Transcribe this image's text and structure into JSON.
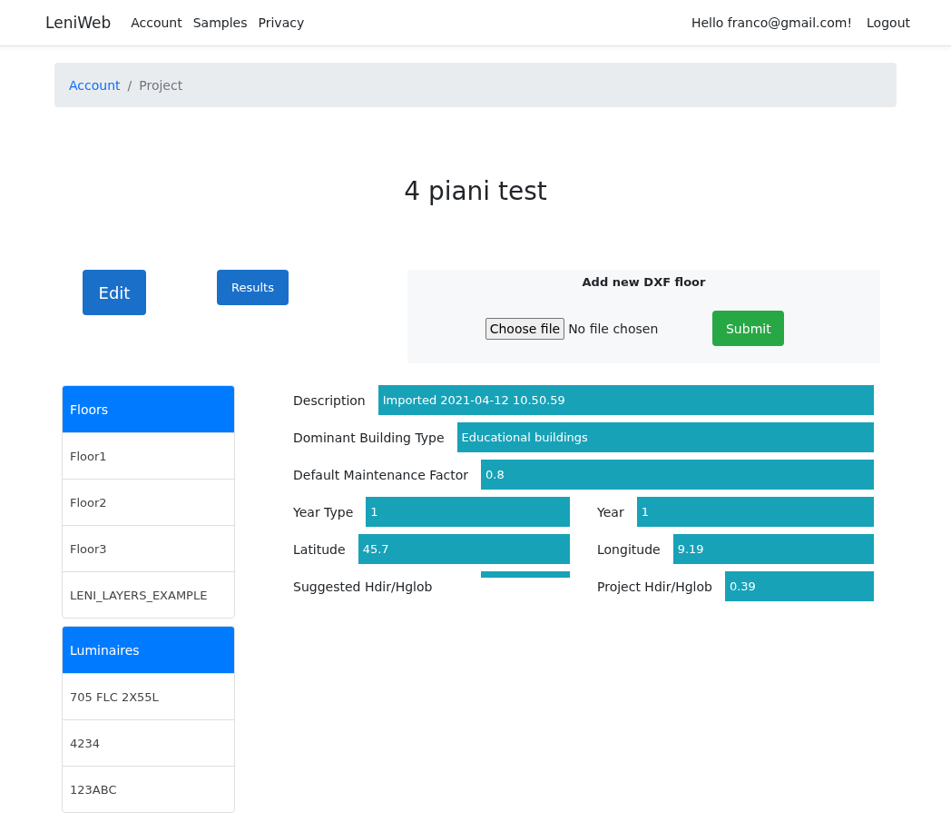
{
  "navbar": {
    "brand": "LeniWeb",
    "links": [
      "Account",
      "Samples",
      "Privacy"
    ],
    "greeting": "Hello franco@gmail.com!",
    "logout": "Logout"
  },
  "breadcrumb": {
    "separator": "/",
    "items": [
      {
        "label": "Account",
        "link": true
      },
      {
        "label": "Project",
        "link": false
      }
    ]
  },
  "title": "4 piani test",
  "actions": {
    "edit": "Edit",
    "results": "Results"
  },
  "upload": {
    "title": "Add new DXF floor",
    "choose": "Choose file",
    "status": "No file chosen",
    "submit": "Submit"
  },
  "lists": [
    {
      "header": "Floors",
      "items": [
        "Floor1",
        "Floor2",
        "Floor3",
        "LENI_LAYERS_EXAMPLE"
      ]
    },
    {
      "header": "Luminaires",
      "items": [
        "705 FLC 2X55L",
        "4234",
        "123ABC"
      ]
    }
  ],
  "fields": [
    {
      "kind": "wide",
      "label": "Description",
      "value": "Imported 2021-04-12 10.50.59"
    },
    {
      "kind": "wide",
      "label": "Dominant Building Type",
      "value": "Educational buildings"
    },
    {
      "kind": "wide",
      "label": "Default Maintenance Factor",
      "value": "0.8"
    },
    {
      "kind": "half",
      "label": "Year Type",
      "value": "1"
    },
    {
      "kind": "half",
      "label": "Year",
      "value": "1"
    },
    {
      "kind": "half",
      "label": "Latitude",
      "value": "45.7"
    },
    {
      "kind": "half",
      "label": "Longitude",
      "value": "9.19"
    },
    {
      "kind": "half",
      "label": "Suggested Hdir/Hglob"
    },
    {
      "kind": "half",
      "label": "Project Hdir/Hglob",
      "value": "0.39"
    }
  ]
}
